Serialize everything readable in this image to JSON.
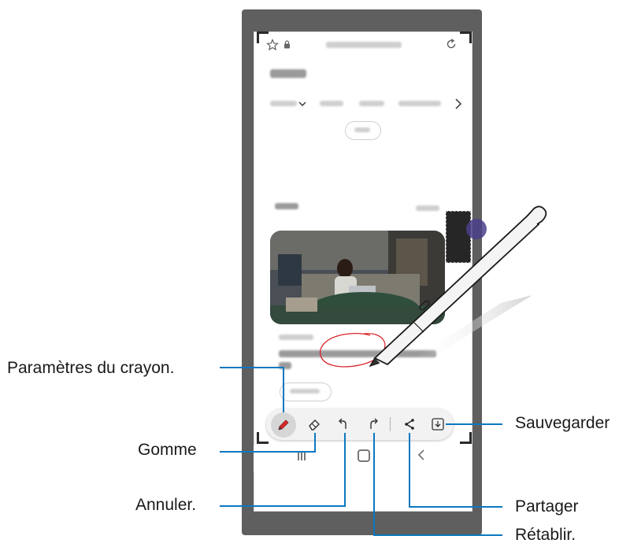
{
  "callouts": {
    "pen_settings": "Paramètres du crayon.",
    "eraser": "Gomme",
    "undo": "Annuler.",
    "redo": "Rétablir.",
    "share": "Partager",
    "save": "Sauvegarder"
  },
  "toolbar": {
    "items": [
      "pen-settings",
      "eraser",
      "undo",
      "redo",
      "share",
      "save"
    ],
    "active": "pen-settings",
    "accent_color": "#d9262c"
  },
  "colors": {
    "leader_line": "#0b78c0",
    "phone_frame": "#5f5f5f",
    "annotation_ink": "#d9262c"
  },
  "icons": {
    "browser_star": "star-icon",
    "browser_lock": "lock-icon",
    "browser_refresh": "refresh-icon",
    "chevron": "chevron-right-icon"
  }
}
